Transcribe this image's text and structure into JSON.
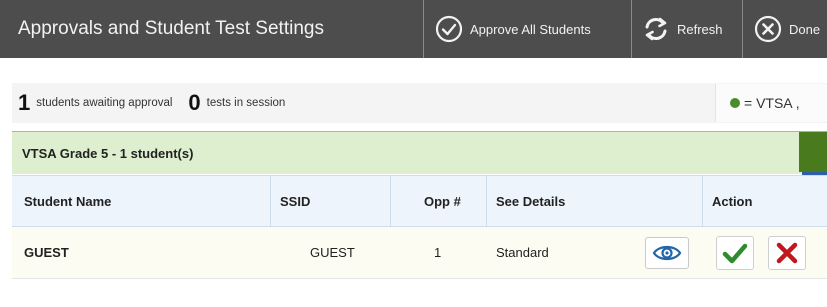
{
  "header": {
    "title": "Approvals and Student Test Settings",
    "approve_all_label": "Approve All Students",
    "refresh_label": "Refresh",
    "done_label": "Done"
  },
  "status": {
    "awaiting_count": "1",
    "awaiting_text": "students awaiting approval",
    "in_session_count": "0",
    "in_session_text": "tests in session",
    "legend_text": "= VTSA ,"
  },
  "group": {
    "label": "VTSA Grade 5 - 1 student(s)"
  },
  "table": {
    "columns": [
      "Student Name",
      "SSID",
      "Opp #",
      "See Details",
      "Action"
    ],
    "rows": [
      {
        "student_name": "GUEST",
        "ssid": "GUEST",
        "opp": "1",
        "details": "Standard"
      }
    ]
  },
  "colors": {
    "header_bg": "#4d4d4d",
    "group_bg": "#ddefcf",
    "approve_green": "#2e8b2e",
    "deny_red": "#c0181f",
    "eye_blue": "#2566a8"
  },
  "icons": [
    "approve-all-check-icon",
    "refresh-icon",
    "close-icon",
    "vtsa-legend-dot",
    "eye-icon",
    "approve-check-icon",
    "deny-x-icon"
  ]
}
